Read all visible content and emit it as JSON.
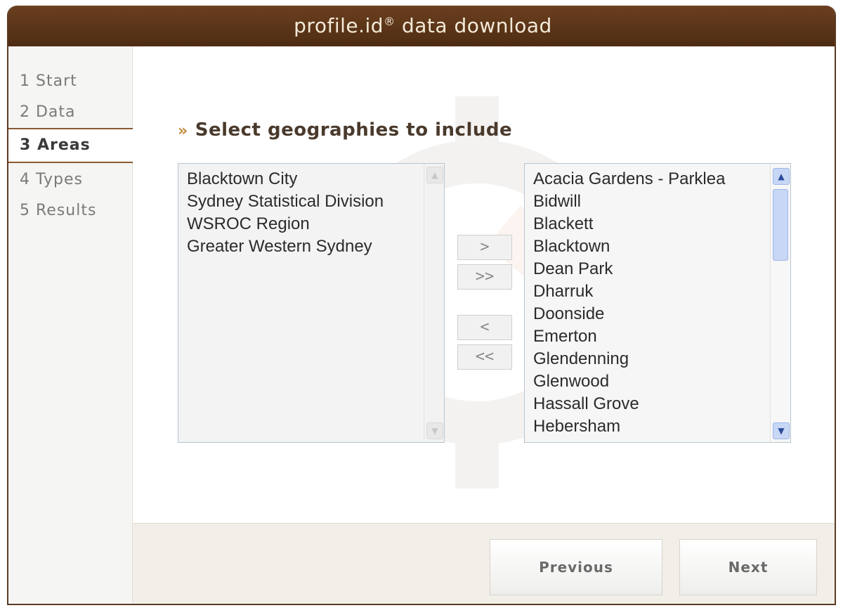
{
  "window": {
    "title": "profile.id",
    "title_mark": "®",
    "title_suffix": "data download"
  },
  "sidebar": {
    "steps": [
      {
        "label": "1 Start",
        "active": false
      },
      {
        "label": "2 Data",
        "active": false
      },
      {
        "label": "3 Areas",
        "active": true
      },
      {
        "label": "4 Types",
        "active": false
      },
      {
        "label": "5 Results",
        "active": false
      }
    ]
  },
  "main": {
    "chevron": "»",
    "heading": "Select geographies to include",
    "left_list": {
      "items": [
        "Blacktown City",
        "Sydney Statistical Division",
        "WSROC Region",
        "Greater Western Sydney"
      ]
    },
    "right_list": {
      "items": [
        "Acacia Gardens - Parklea",
        "Bidwill",
        "Blackett",
        "Blacktown",
        "Dean Park",
        "Dharruk",
        "Doonside",
        "Emerton",
        "Glendenning",
        "Glenwood",
        "Hassall Grove",
        "Hebersham"
      ]
    },
    "move_buttons": {
      "add": ">",
      "add_all": ">>",
      "remove": "<",
      "remove_all": "<<"
    }
  },
  "footer": {
    "previous_label": "Previous",
    "next_label": "Next"
  },
  "colors": {
    "title_bar": "#5a3417",
    "active_border": "#8b5a33",
    "heading_chevron": "#c08a3c"
  }
}
